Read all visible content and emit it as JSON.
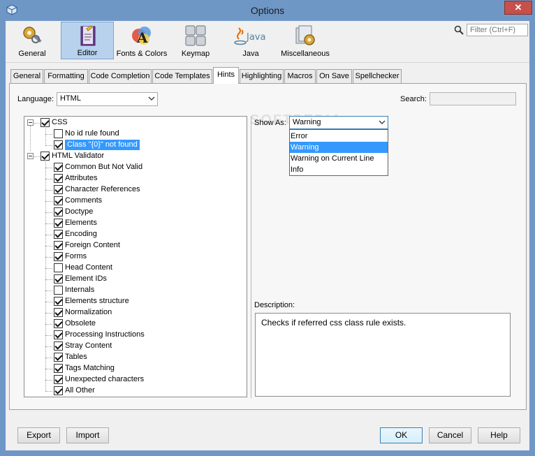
{
  "window": {
    "title": "Options",
    "close_glyph": "✕"
  },
  "categories": [
    {
      "label": "General",
      "icon": "gears-icon"
    },
    {
      "label": "Editor",
      "icon": "editor-icon",
      "selected": true
    },
    {
      "label": "Fonts & Colors",
      "icon": "fonts-colors-icon"
    },
    {
      "label": "Keymap",
      "icon": "keymap-icon"
    },
    {
      "label": "Java",
      "icon": "java-icon"
    },
    {
      "label": "Miscellaneous",
      "icon": "misc-icon"
    }
  ],
  "filter": {
    "placeholder": "Filter (Ctrl+F)"
  },
  "tabs": [
    "General",
    "Formatting",
    "Code Completion",
    "Code Templates",
    "Hints",
    "Highlighting",
    "Macros",
    "On Save",
    "Spellchecker"
  ],
  "active_tab": "Hints",
  "language": {
    "label": "Language:",
    "value": "HTML"
  },
  "search": {
    "label": "Search:",
    "value": ""
  },
  "tree": {
    "groups": [
      {
        "label": "CSS",
        "checked": true,
        "items": [
          {
            "label": "No id rule found",
            "checked": false
          },
          {
            "label": "Class \"{0}\" not found",
            "checked": true,
            "selected": true
          }
        ]
      },
      {
        "label": "HTML Validator",
        "checked": true,
        "items": [
          {
            "label": "Common But Not Valid",
            "checked": true
          },
          {
            "label": "Attributes",
            "checked": true
          },
          {
            "label": "Character References",
            "checked": true
          },
          {
            "label": "Comments",
            "checked": true
          },
          {
            "label": "Doctype",
            "checked": true
          },
          {
            "label": "Elements",
            "checked": true
          },
          {
            "label": "Encoding",
            "checked": true
          },
          {
            "label": "Foreign Content",
            "checked": true
          },
          {
            "label": "Forms",
            "checked": true
          },
          {
            "label": "Head Content",
            "checked": false
          },
          {
            "label": "Element IDs",
            "checked": true
          },
          {
            "label": "Internals",
            "checked": false
          },
          {
            "label": "Elements structure",
            "checked": true
          },
          {
            "label": "Normalization",
            "checked": true
          },
          {
            "label": "Obsolete",
            "checked": true
          },
          {
            "label": "Processing Instructions",
            "checked": true
          },
          {
            "label": "Stray Content",
            "checked": true
          },
          {
            "label": "Tables",
            "checked": true
          },
          {
            "label": "Tags Matching",
            "checked": true
          },
          {
            "label": "Unexpected characters",
            "checked": true
          },
          {
            "label": "All Other",
            "checked": true
          }
        ]
      }
    ]
  },
  "show_as": {
    "label": "Show As:",
    "value": "Warning",
    "options": [
      "Error",
      "Warning",
      "Warning on Current Line",
      "Info"
    ],
    "selected_index": 1
  },
  "description": {
    "label": "Description:",
    "text": "Checks if referred css class rule exists."
  },
  "watermark": "SOFTPEDIA",
  "buttons": {
    "export": "Export",
    "import": "Import",
    "ok": "OK",
    "cancel": "Cancel",
    "help": "Help"
  }
}
